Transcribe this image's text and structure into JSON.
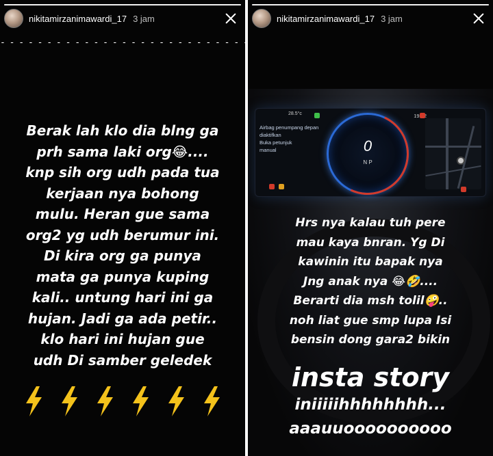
{
  "stories": [
    {
      "username": "nikitamirzanimawardi_17",
      "timestamp": "3 jam",
      "progress": 1.0,
      "dashes": "- - - - - - - - - - - - - - - - - - - - - - - - - - - - - - - - - - - - - - - - - -",
      "text": "Berak lah klo dia blng ga\nprh sama laki org😂....\nknp sih org udh pada tua\nkerjaan nya bohong\nmulu. Heran gue sama\norg2 yg udh berumur ini.\nDi kira org ga punya\nmata ga punya kuping\nkali.. untung hari ini ga\nhujan. Jadi ga ada petir..\nklo hari ini hujan  gue\nudh Di samber geledek",
      "bolt_icons": [
        "lightning-icon",
        "lightning-icon",
        "lightning-icon",
        "lightning-icon",
        "lightning-icon",
        "lightning-icon"
      ]
    },
    {
      "username": "nikitamirzanimawardi_17",
      "timestamp": "3 jam",
      "progress": 1.0,
      "text": "Hrs nya kalau tuh pere\nmau kaya bnran. Yg Di\nkawinin itu bapak nya\nJng anak nya 😂🤣....\nBerarti dia msh tolil🤪..\nnoh liat gue smp lupa Isi\nbensin dong gara2 bikin",
      "big_text": "insta story",
      "tail_1": "iniiiiihhhhhhhh...",
      "tail_2": "aaauuoooooooooo",
      "dashboard": {
        "temperature": "28.5°c",
        "clock": "19:22",
        "notice": "Airbag penumpang depan\ndiaktifkan\nBuka petunjuk\nmanual",
        "speed": "0",
        "gear": "N  P"
      }
    }
  ],
  "colors": {
    "background": "#050505",
    "text": "#ffffff",
    "gauge_blue": "#2b6ad6",
    "bolt": "#f4c21b"
  }
}
